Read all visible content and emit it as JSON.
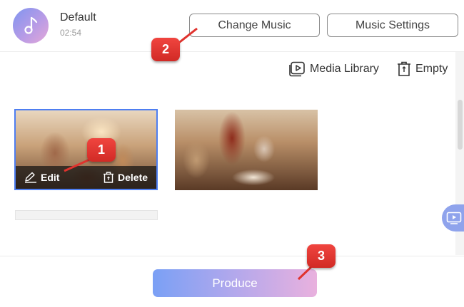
{
  "header": {
    "track_name": "Default",
    "track_duration": "02:54",
    "music_icon": "music-note-icon",
    "change_music_label": "Change Music",
    "music_settings_label": "Music Settings"
  },
  "toolbar": {
    "media_library_label": "Media Library",
    "media_library_icon": "media-library-icon",
    "empty_label": "Empty",
    "empty_icon": "trash-icon"
  },
  "clips": [
    {
      "edit_label": "Edit",
      "delete_label": "Delete",
      "selected": true
    },
    {
      "selected": false
    }
  ],
  "footer": {
    "produce_label": "Produce"
  },
  "callouts": [
    "1",
    "2",
    "3"
  ],
  "colors": {
    "accent": "#4e7ef1",
    "callout": "#e0332e",
    "produce_gradient_start": "#7aa0f5",
    "produce_gradient_end": "#e9b1de"
  }
}
